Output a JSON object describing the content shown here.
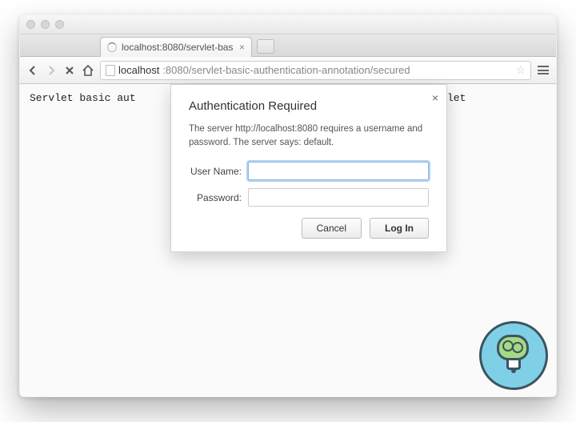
{
  "tab": {
    "title": "localhost:8080/servlet-bas"
  },
  "omnibox": {
    "host": "localhost",
    "rest": ":8080/servlet-basic-authentication-annotation/secured"
  },
  "page": {
    "body_left": "Servlet basic aut",
    "body_right": "let"
  },
  "dialog": {
    "title": "Authentication Required",
    "message": "The server http://localhost:8080 requires a username and password. The server says: default.",
    "username_label": "User Name:",
    "password_label": "Password:",
    "username_value": "",
    "password_value": "",
    "cancel_label": "Cancel",
    "login_label": "Log In"
  }
}
